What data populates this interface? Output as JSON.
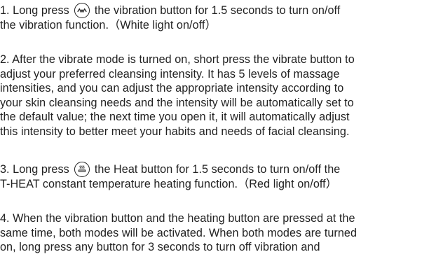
{
  "instructions": [
    {
      "lines": [
        {
          "before": "1. Long press",
          "icon": "vibration-wave-icon",
          "after": "the vibration button for 1.5 seconds to turn on/off"
        },
        {
          "text": "the vibration function.（White light on/off）"
        }
      ]
    },
    {
      "lines": [
        {
          "text": "2. After the vibrate mode is turned on, short press the vibrate button to"
        },
        {
          "text": "adjust your preferred cleansing intensity. It has 5 levels of massage"
        },
        {
          "text": "intensities, and you can adjust the appropriate intensity according to"
        },
        {
          "text": "your skin cleansing needs and the intensity will be automatically set to"
        },
        {
          "text": "the default value; the next time you open it, it will automatically adjust"
        },
        {
          "text": "this intensity to better meet your habits and needs of facial cleansing."
        }
      ]
    },
    {
      "lines": [
        {
          "before": "3. Long press",
          "icon": "heat-icon",
          "after": "the Heat button for 1.5 seconds to turn on/off the"
        },
        {
          "text": "T-HEAT constant temperature heating function.（Red light on/off）"
        }
      ]
    },
    {
      "lines": [
        {
          "text": "4. When the vibration button and the heating button are pressed at the"
        },
        {
          "text": "same time, both modes will be activated. When both modes are turned"
        },
        {
          "text": "on, long press any button for 3 seconds to turn off vibration and"
        }
      ]
    }
  ]
}
